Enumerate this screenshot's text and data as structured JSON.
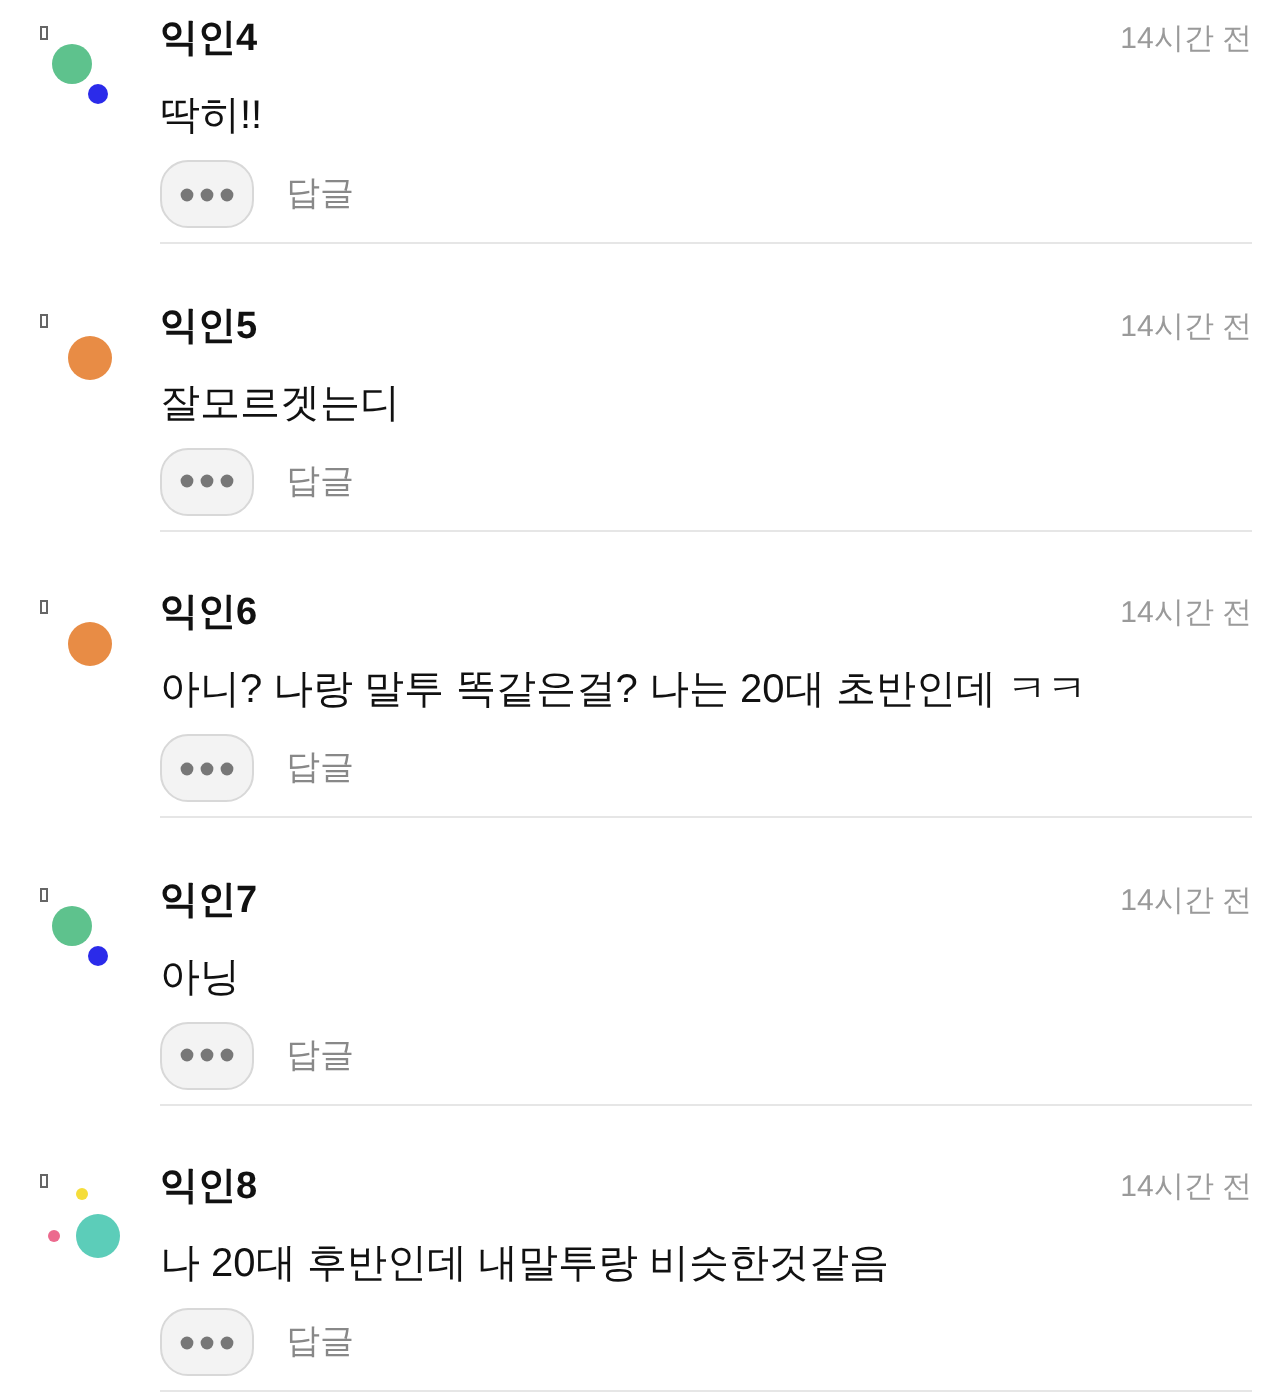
{
  "comments": [
    {
      "author": "익인4",
      "time": "14시간 전",
      "text": "딱히!!",
      "avatar": {
        "kind": "pair",
        "dots": [
          {
            "color": "#5ec28d"
          },
          {
            "color": "#2b2bea"
          }
        ]
      },
      "reply": "답글"
    },
    {
      "author": "익인5",
      "time": "14시간 전",
      "text": "잘모르겟는디",
      "avatar": {
        "kind": "single",
        "dots": [
          {
            "color": "#e88c45"
          }
        ]
      },
      "reply": "답글"
    },
    {
      "author": "익인6",
      "time": "14시간 전",
      "text": "아니? 나랑 말투 똑같은걸? 나는 20대 초반인데 ㅋㅋ",
      "avatar": {
        "kind": "single",
        "dots": [
          {
            "color": "#e88c45"
          }
        ]
      },
      "reply": "답글"
    },
    {
      "author": "익인7",
      "time": "14시간 전",
      "text": "아닝",
      "avatar": {
        "kind": "pair",
        "dots": [
          {
            "color": "#5ec28d"
          },
          {
            "color": "#2b2bea"
          }
        ]
      },
      "reply": "답글"
    },
    {
      "author": "익인8",
      "time": "14시간 전",
      "text": "나 20대 후반인데 내말투랑 비슷한것같음",
      "avatar": {
        "kind": "trio",
        "dots": [
          {
            "color": "#5ccdb9"
          },
          {
            "color": "#f5dd3a"
          },
          {
            "color": "#ec6a8e"
          }
        ]
      },
      "reply": "답글"
    }
  ]
}
